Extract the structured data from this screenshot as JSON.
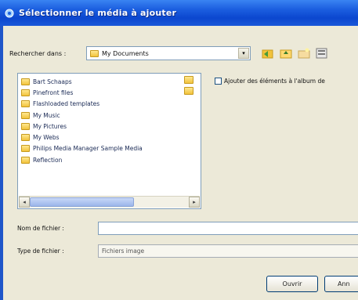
{
  "window": {
    "title": "Sélectionner le média à ajouter"
  },
  "look_in": {
    "label": "Rechercher dans :",
    "value": "My Documents",
    "dropdown_icon": "▾"
  },
  "toolbar": {
    "icons": [
      "back-icon",
      "up-folder-icon",
      "new-folder-icon",
      "view-menu-icon"
    ]
  },
  "files": [
    {
      "name": "Bart Schaaps"
    },
    {
      "name": "Pinefront files"
    },
    {
      "name": "Flashloaded templates"
    },
    {
      "name": "My Music"
    },
    {
      "name": "My Pictures"
    },
    {
      "name": "My Webs"
    },
    {
      "name": "Philips Media Manager Sample Media"
    },
    {
      "name": "Reflection"
    }
  ],
  "checkbox": {
    "label": "Ajouter des éléments à l'album de",
    "checked": false
  },
  "filename": {
    "label": "Nom de fichier :",
    "value": ""
  },
  "filetype": {
    "label": "Type de fichier :",
    "value": "Fichiers image"
  },
  "buttons": {
    "open": "Ouvrir",
    "cancel": "Ann"
  },
  "colors": {
    "titlebar": "#0b47cf",
    "background": "#ece9d8",
    "folder": "#f2c33c"
  }
}
